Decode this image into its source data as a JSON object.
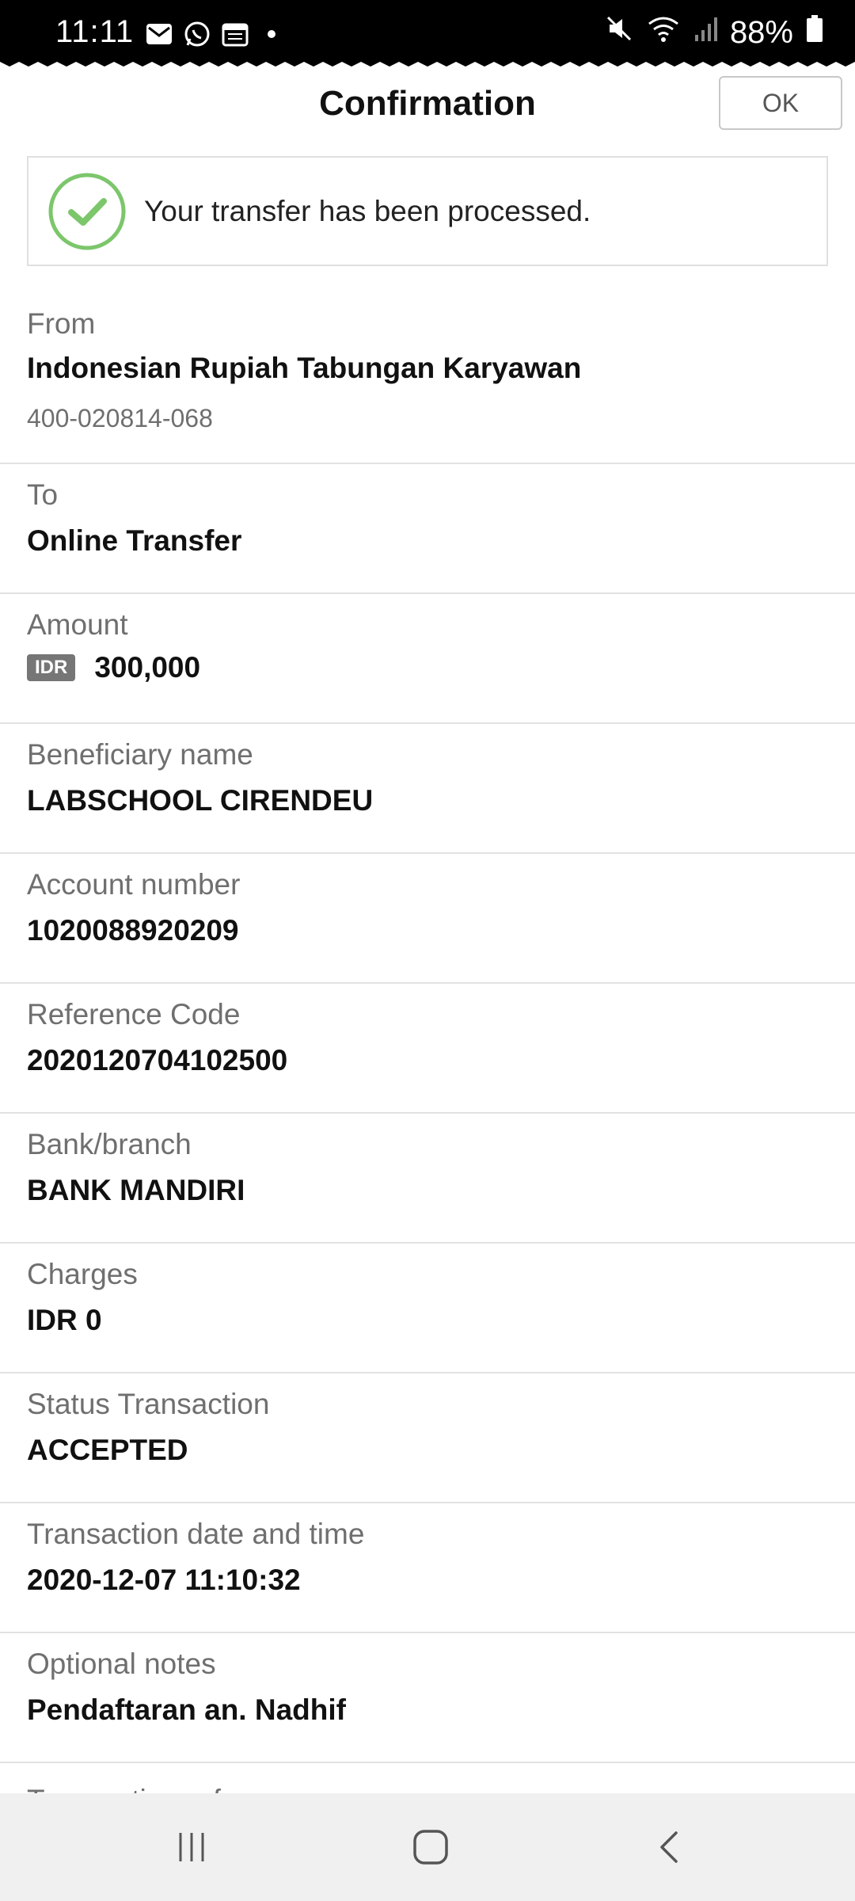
{
  "status_bar": {
    "time": "11:11",
    "battery": "88%",
    "notification_icons": [
      "mail-icon",
      "whatsapp-icon",
      "calendar-icon",
      "dot-icon"
    ],
    "system_icons": [
      "mute-icon",
      "wifi-icon",
      "signal-icon",
      "battery-icon"
    ]
  },
  "header": {
    "title": "Confirmation",
    "ok_label": "OK"
  },
  "success": {
    "message": "Your transfer has been processed.",
    "icon": "check-circle-icon",
    "color": "#7cc66b"
  },
  "details": {
    "from": {
      "label": "From",
      "value": "Indonesian Rupiah Tabungan Karyawan",
      "account": "400-020814-068"
    },
    "to": {
      "label": "To",
      "value": "Online Transfer"
    },
    "amount": {
      "label": "Amount",
      "currency": "IDR",
      "value": "300,000"
    },
    "beneficiary": {
      "label": "Beneficiary name",
      "value": "LABSCHOOL CIRENDEU"
    },
    "account_number": {
      "label": "Account number",
      "value": "1020088920209"
    },
    "reference_code": {
      "label": "Reference Code",
      "value": "2020120704102500"
    },
    "bank_branch": {
      "label": "Bank/branch",
      "value": "BANK MANDIRI"
    },
    "charges": {
      "label": "Charges",
      "value": "IDR 0"
    },
    "status": {
      "label": "Status Transaction",
      "value": "ACCEPTED"
    },
    "transaction_datetime": {
      "label": "Transaction date and time",
      "value": "2020-12-07 11:10:32"
    },
    "notes": {
      "label": "Optional notes",
      "value": "Pendaftaran an. Nadhif"
    },
    "partial_label": "Transaction ref"
  },
  "navbar": {
    "icons": [
      "recent-apps-icon",
      "home-icon",
      "back-icon"
    ]
  }
}
